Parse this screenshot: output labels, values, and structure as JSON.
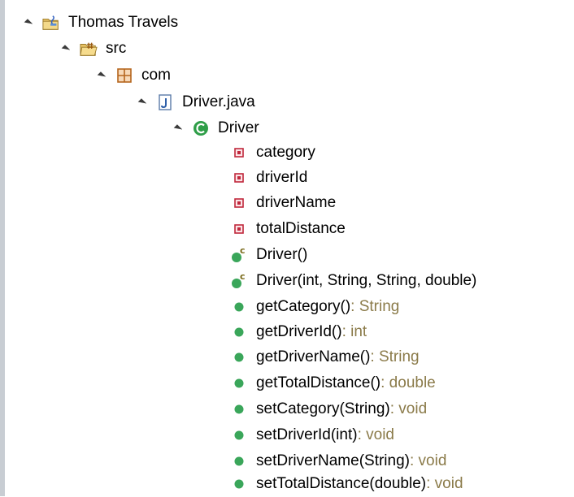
{
  "tree": {
    "project": {
      "label": "Thomas Travels"
    },
    "source_folder": {
      "label": "src"
    },
    "package": {
      "label": "com"
    },
    "file": {
      "label": "Driver.java"
    },
    "class": {
      "label": "Driver"
    },
    "fields": [
      "category",
      "driverId",
      "driverName",
      "totalDistance"
    ],
    "constructors": [
      "Driver()",
      "Driver(int, String, String, double)"
    ],
    "methods": [
      {
        "name": "getCategory()",
        "type": " : String"
      },
      {
        "name": "getDriverId()",
        "type": " : int"
      },
      {
        "name": "getDriverName()",
        "type": " : String"
      },
      {
        "name": "getTotalDistance()",
        "type": " : double"
      },
      {
        "name": "setCategory(String)",
        "type": " : void"
      },
      {
        "name": "setDriverId(int)",
        "type": " : void"
      },
      {
        "name": "setDriverName(String)",
        "type": " : void"
      },
      {
        "name": "setTotalDistance(double)",
        "type": " : void"
      }
    ]
  },
  "icons": {
    "project": "java-project-icon",
    "source_folder": "source-folder-icon",
    "package": "package-icon",
    "file": "java-file-icon",
    "class": "class-icon",
    "field": "private-field-icon",
    "constructor": "constructor-icon",
    "method": "public-method-icon"
  },
  "colors": {
    "field": "#c0283c",
    "method": "#3aa65a",
    "class": "#2f9e48",
    "return_type": "#8b7b4a"
  }
}
